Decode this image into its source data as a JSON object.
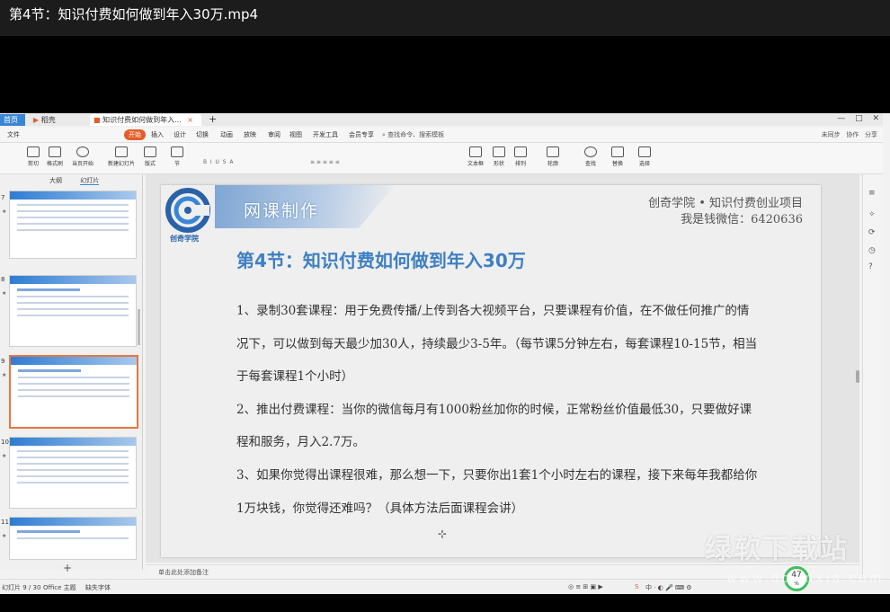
{
  "video": {
    "title": "第4节：知识付费如何做到年入30万.mp4"
  },
  "tabs": {
    "home": "首页",
    "wps": "稻壳",
    "doc": "知识付费如何做到年入...",
    "close": "×",
    "new_tab": "+"
  },
  "menu": {
    "file": "文件",
    "start": "开始",
    "items": [
      "插入",
      "设计",
      "切换",
      "动画",
      "放映",
      "审阅",
      "视图",
      "开发工具",
      "会员专享"
    ],
    "search": "查找命令、搜索模板",
    "right": [
      "未同步",
      "协作",
      "分享"
    ]
  },
  "ribbon": {
    "buttons": [
      "剪切",
      "格式刷",
      "当页开始",
      "新建幻灯片",
      "版式",
      "节",
      "文本框",
      "形状",
      "排列",
      "轮廓",
      "查找",
      "替换",
      "选择"
    ]
  },
  "left_panel": {
    "tabs": [
      "大纲",
      "幻灯片"
    ],
    "slide_numbers": [
      "7",
      "8",
      "9",
      "10",
      "11"
    ],
    "add_button": "+"
  },
  "slide": {
    "logo_text": "创奇学院",
    "banner": "网课制作",
    "org_line1": "创奇学院 • 知识付费创业项目",
    "org_line2": "我是钱微信：6420636",
    "heading": "第4节：知识付费如何做到年入30万",
    "paragraphs": [
      "1、录制30套课程：用于免费传播/上传到各大视频平台，只要课程有价值，在不做任何推广的情况下，可以做到每天最少加30人，持续最少3-5年。（每节课5分钟左右，每套课程10-15节，相当于每套课程1个小时）",
      "2、推出付费课程：当你的微信每月有1000粉丝加你的时候，正常粉丝价值最低30，只要做好课程和服务，月入2.7万。",
      "3、如果你觉得出课程很难，那么想一下，只要你出1套1个小时左右的课程，接下来每年我都给你1万块钱，你觉得还难吗？（具体方法后面课程会讲）"
    ]
  },
  "notes": {
    "placeholder": "单击此处添加备注"
  },
  "status": {
    "slide_count": "幻灯片 9 / 30",
    "theme": "Office 主题",
    "font": "缺失字体",
    "zoom_percent": "47",
    "zoom_unit": "%"
  },
  "watermark": {
    "line1": "绿软下载站",
    "line2": "www.downxia.com"
  }
}
